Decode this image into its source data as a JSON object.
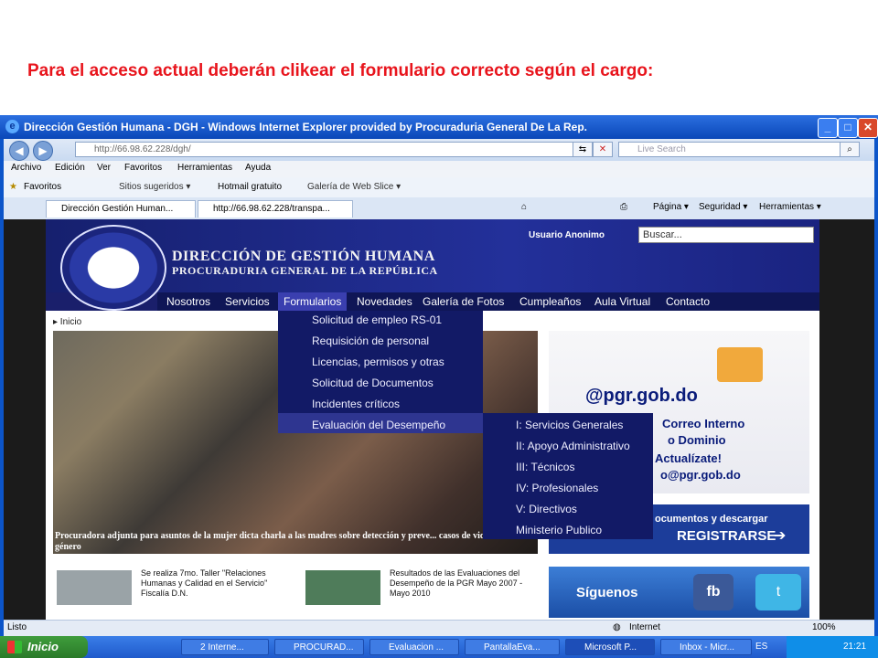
{
  "caption": "Para el acceso actual deberán clikear el formulario correcto según el cargo:",
  "window": {
    "title": "Dirección Gestión Humana - DGH - Windows Internet Explorer provided by Procuraduria General De La Rep.",
    "address": "http://66.98.62.228/dgh/",
    "search_placeholder": "Live Search"
  },
  "menu": [
    "Archivo",
    "Edición",
    "Ver",
    "Favoritos",
    "Herramientas",
    "Ayuda"
  ],
  "favorites": {
    "label": "Favoritos",
    "items": [
      "Sitios sugeridos ▾",
      "Hotmail gratuito",
      "Galería de Web Slice ▾"
    ]
  },
  "tabs": [
    "Dirección Gestión Human...",
    "http://66.98.62.228/transpa..."
  ],
  "commands": [
    "Página ▾",
    "Seguridad ▾",
    "Herramientas ▾"
  ],
  "site": {
    "title": "DIRECCIÓN DE GESTIÓN HUMANA",
    "subtitle": "PROCURADURIA GENERAL DE LA REPÚBLICA",
    "user": "Usuario Anonimo",
    "search_placeholder": "Buscar...",
    "nav": [
      "Nosotros",
      "Servicios",
      "Formularios",
      "Novedades",
      "Galería de Fotos",
      "Cumpleaños",
      "Aula Virtual",
      "Contacto"
    ],
    "breadcrumb": "▸ Inicio",
    "photo_caption": "Procuradora adjunta para asuntos de la mujer dicta charla a las madres sobre detección y preve... casos de violencia de género",
    "dropdown": [
      "Solicitud de empleo RS-01",
      "Requisición de personal",
      "Licencias, permisos y otras",
      "Solicitud de Documentos",
      "Incidentes críticos",
      "Evaluación del Desempeño"
    ],
    "submenu": [
      "I: Servicios Generales",
      "II: Apoyo Administrativo",
      "III: Técnicos",
      "IV: Profesionales",
      "V: Directivos",
      "Ministerio Publico"
    ],
    "promo_email": "@pgr.gob.do",
    "promo_lines": [
      "Correo Interno",
      "o Dominio",
      "Actualízate!",
      "o@pgr.gob.do"
    ],
    "register": "REGISTRARSE",
    "register_prefix": "ocumentos y descargar",
    "follow": "Síguenos",
    "news": [
      {
        "text": "Se realiza 7mo. Taller \"Relaciones Humanas y Calidad en el Servicio\" Fiscalía D.N."
      },
      {
        "text": "Resultados de las Evaluaciones del Desempeño de la PGR Mayo 2007 - Mayo 2010"
      }
    ]
  },
  "status": {
    "left": "Listo",
    "zone": "Internet",
    "zoom": "100%"
  },
  "taskbar": {
    "start": "Inicio",
    "items": [
      "2 Interne...",
      "PROCURAD...",
      "Evaluacion ...",
      "PantallaEva...",
      "Microsoft P...",
      "Inbox - Micr..."
    ],
    "lang": "ES",
    "time": "21:21"
  }
}
